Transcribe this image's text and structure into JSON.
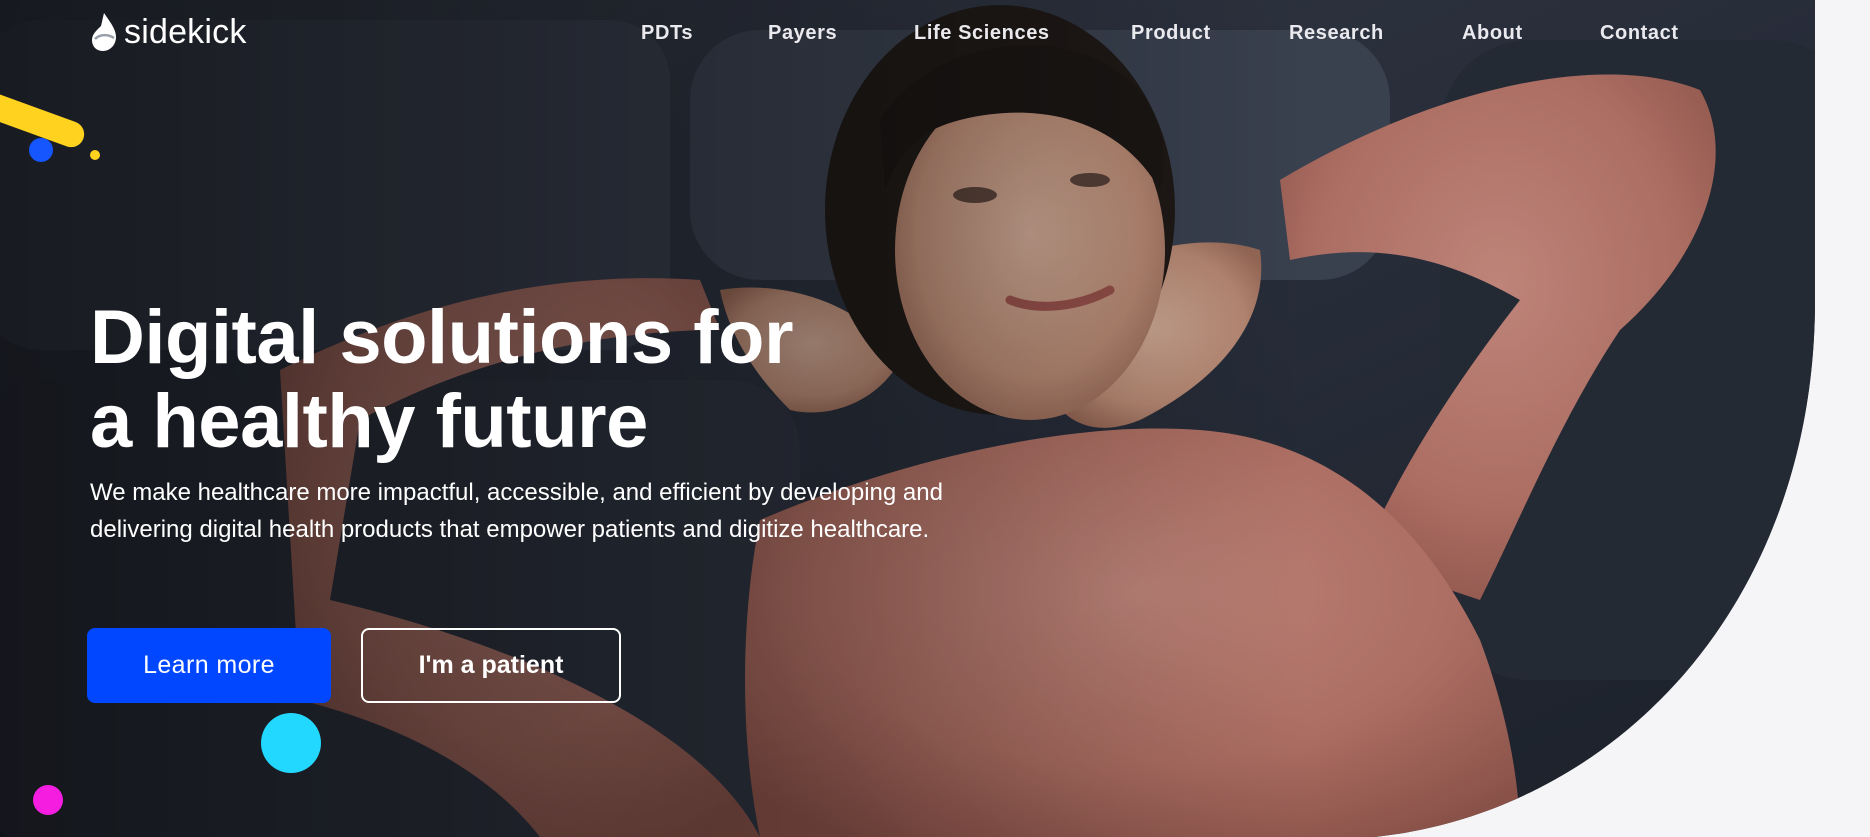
{
  "brand": {
    "name": "sidekick"
  },
  "nav": {
    "items": [
      {
        "label": "PDTs"
      },
      {
        "label": "Payers"
      },
      {
        "label": "Life Sciences"
      },
      {
        "label": "Product"
      },
      {
        "label": "Research"
      },
      {
        "label": "About"
      },
      {
        "label": "Contact"
      }
    ]
  },
  "hero": {
    "headline_line1": "Digital solutions for",
    "headline_line2": "a healthy future",
    "subtext": "We make healthcare more impactful, accessible, and efficient by developing and delivering digital health products that empower patients and digitize healthcare.",
    "primary_cta": "Learn more",
    "secondary_cta": "I'm a patient",
    "image_icon": "woman-relaxing-photo"
  },
  "colors": {
    "primary_button": "#0047ff",
    "accent_yellow": "#ffd21f",
    "accent_blue": "#1556ff",
    "accent_cyan": "#22d8ff",
    "accent_magenta": "#f51ee0",
    "page_background": "#f5f5f8"
  }
}
